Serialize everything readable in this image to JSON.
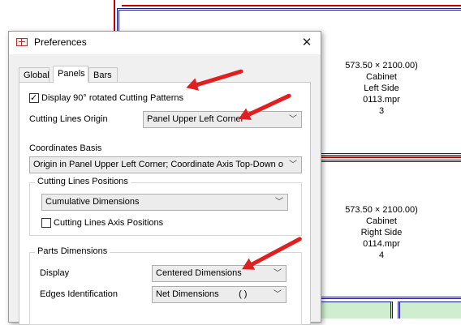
{
  "dialog": {
    "title": "Preferences",
    "close_glyph": "✕"
  },
  "tabs": [
    {
      "label": "Global",
      "active": false
    },
    {
      "label": "Panels",
      "active": true
    },
    {
      "label": "Bars",
      "active": false
    }
  ],
  "panels_tab": {
    "display_rotated": {
      "label": "Display 90° rotated Cutting Patterns",
      "checked": true
    },
    "cutting_lines_origin": {
      "label": "Cutting Lines Origin",
      "value": "Panel Upper Left Corner"
    },
    "coordinates_basis": {
      "label": "Coordinates Basis",
      "value": "Origin in Panel Upper Left Corner; Coordinate Axis Top-Down orie"
    },
    "cutting_lines_positions": {
      "title": "Cutting Lines Positions",
      "value": "Cumulative Dimensions",
      "axis_positions": {
        "label": "Cutting Lines Axis Positions",
        "checked": false
      }
    },
    "parts_dimensions": {
      "title": "Parts Dimensions",
      "display": {
        "label": "Display",
        "value": "Centered Dimensions"
      },
      "edges_identification": {
        "label": "Edges Identification",
        "value": "Net Dimensions        ( )"
      }
    }
  },
  "background_panels": [
    {
      "dims": "573.50 × 2100.00)",
      "name": "Cabinet",
      "side": "Left Side",
      "file": "0113.mpr",
      "count": "3"
    },
    {
      "dims": "573.50 × 2100.00)",
      "name": "Cabinet",
      "side": "Right Side",
      "file": "0114.mpr",
      "count": "4"
    }
  ],
  "colors": {
    "annotation_arrow": "#e02020",
    "cut_line": "#c00000",
    "panel_border": "#1a1a7a",
    "part_fill": "#cfeecf"
  }
}
